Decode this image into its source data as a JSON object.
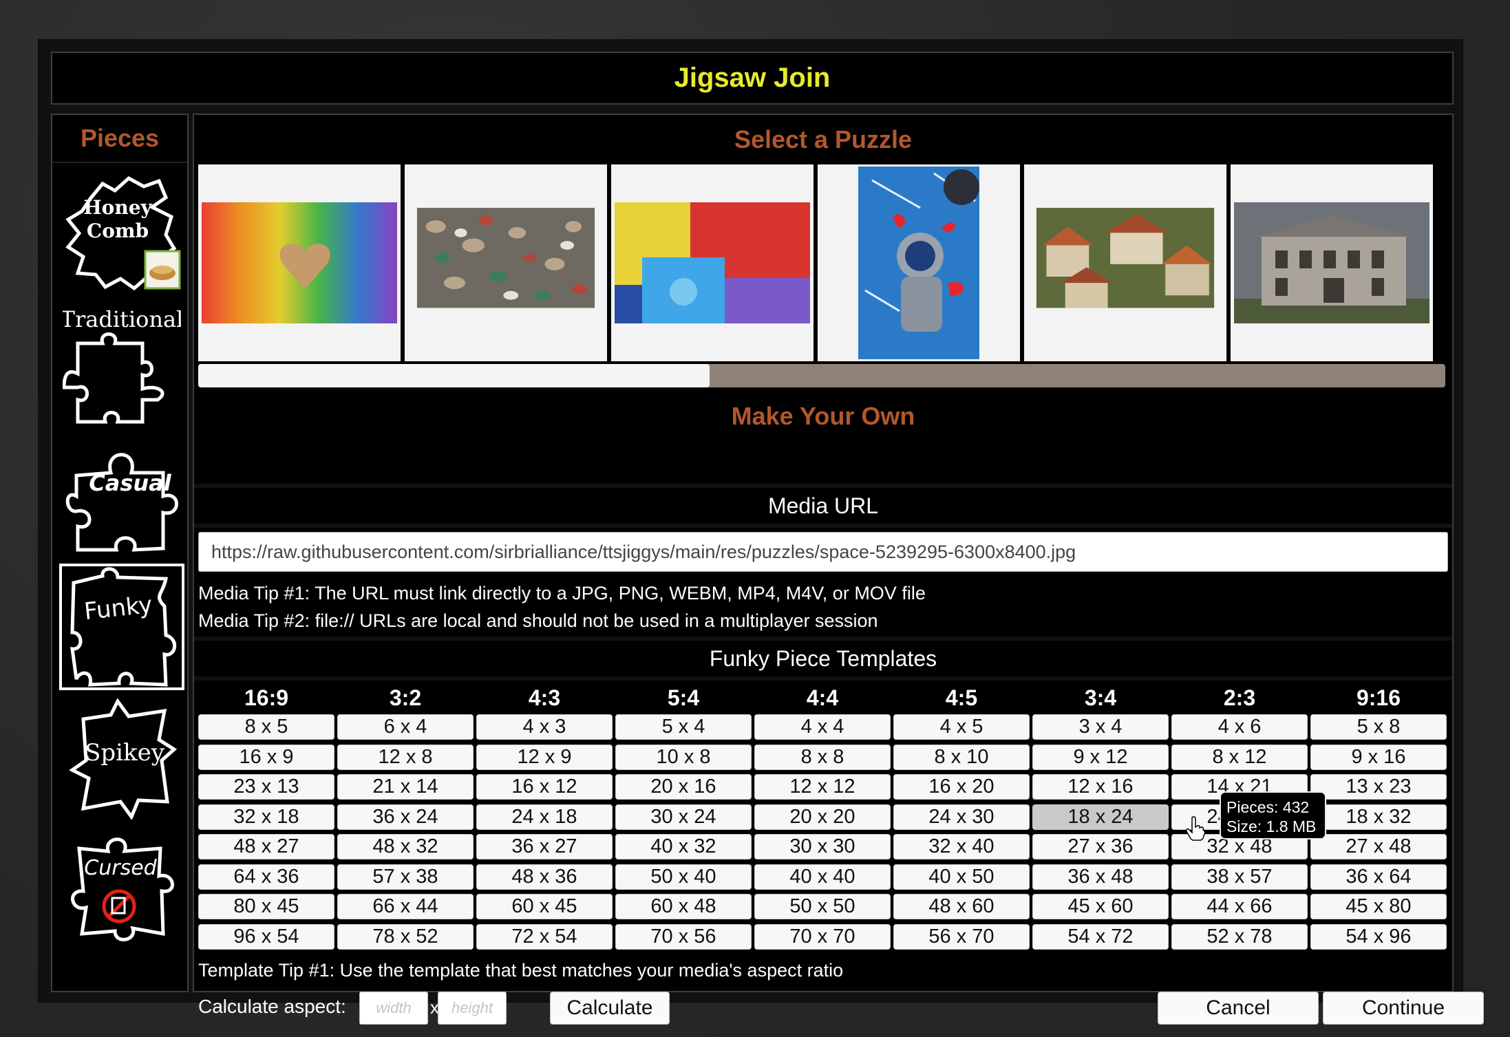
{
  "app": {
    "title": "Jigsaw Join"
  },
  "sidebar": {
    "heading": "Pieces",
    "items": [
      {
        "label": "Honey Comb",
        "line1": "Honey",
        "line2": "Comb",
        "icon": "honeycomb-piece-icon"
      },
      {
        "label": "Traditional",
        "icon": "traditional-piece-icon"
      },
      {
        "label": "Casual",
        "icon": "casual-piece-icon"
      },
      {
        "label": "Funky",
        "icon": "funky-piece-icon",
        "selected": true
      },
      {
        "label": "Spikey",
        "icon": "spikey-piece-icon"
      },
      {
        "label": "Cursed",
        "icon": "cursed-piece-icon"
      }
    ]
  },
  "gallery": {
    "heading": "Select a Puzzle",
    "scroll_fraction": 0.41
  },
  "make_own": {
    "heading": "Make Your Own",
    "media_url_label": "Media URL",
    "media_url_value": "https://raw.githubusercontent.com/sirbrialliance/ttsjiggys/main/res/puzzles/space-5239295-6300x8400.jpg",
    "tip1": "Media Tip #1: The URL must link directly to a JPG, PNG, WEBM, MP4, M4V, or MOV file",
    "tip2": "Media Tip #2: file:// URLs are local and should not be used in a multiplayer session"
  },
  "templates": {
    "heading": "Funky Piece Templates",
    "columns": [
      {
        "ratio": "16:9",
        "sizes": [
          "8 x 5",
          "16 x 9",
          "23 x 13",
          "32 x 18",
          "48 x 27",
          "64 x 36",
          "80 x 45",
          "96 x 54"
        ]
      },
      {
        "ratio": "3:2",
        "sizes": [
          "6 x 4",
          "12 x 8",
          "21 x 14",
          "36 x 24",
          "48 x 32",
          "57 x 38",
          "66 x 44",
          "78 x 52"
        ]
      },
      {
        "ratio": "4:3",
        "sizes": [
          "4 x 3",
          "12 x 9",
          "16 x 12",
          "24 x 18",
          "36 x 27",
          "48 x 36",
          "60 x 45",
          "72 x 54"
        ]
      },
      {
        "ratio": "5:4",
        "sizes": [
          "5 x 4",
          "10 x 8",
          "20 x 16",
          "30 x 24",
          "40 x 32",
          "50 x 40",
          "60 x 48",
          "70 x 56"
        ]
      },
      {
        "ratio": "4:4",
        "sizes": [
          "4 x 4",
          "8 x 8",
          "12 x 12",
          "20 x 20",
          "30 x 30",
          "40 x 40",
          "50 x 50",
          "70 x 70"
        ]
      },
      {
        "ratio": "4:5",
        "sizes": [
          "4 x 5",
          "8 x 10",
          "16 x 20",
          "24 x 30",
          "32 x 40",
          "40 x 50",
          "48 x 60",
          "56 x 70"
        ]
      },
      {
        "ratio": "3:4",
        "sizes": [
          "3 x 4",
          "9 x 12",
          "12 x 16",
          "18 x 24",
          "27 x 36",
          "36 x 48",
          "45 x 60",
          "54 x 72"
        ]
      },
      {
        "ratio": "2:3",
        "sizes": [
          "4 x 6",
          "8 x 12",
          "14 x 21",
          "24 x 36",
          "32 x 48",
          "38 x 57",
          "44 x 66",
          "52 x 78"
        ]
      },
      {
        "ratio": "9:16",
        "sizes": [
          "5 x 8",
          "9 x 16",
          "13 x 23",
          "18 x 32",
          "27 x 48",
          "36 x 64",
          "45 x 80",
          "54 x 96"
        ]
      }
    ],
    "hovered": {
      "column": 6,
      "row": 3
    },
    "tooltip": {
      "pieces": "Pieces: 432",
      "size": "Size: 1.8 MB"
    },
    "tip": "Template Tip #1: Use the template that best matches your media's aspect ratio"
  },
  "calculator": {
    "label": "Calculate aspect:",
    "width_placeholder": "width",
    "separator": "x",
    "height_placeholder": "height",
    "button": "Calculate"
  },
  "actions": {
    "cancel": "Cancel",
    "continue": "Continue"
  }
}
